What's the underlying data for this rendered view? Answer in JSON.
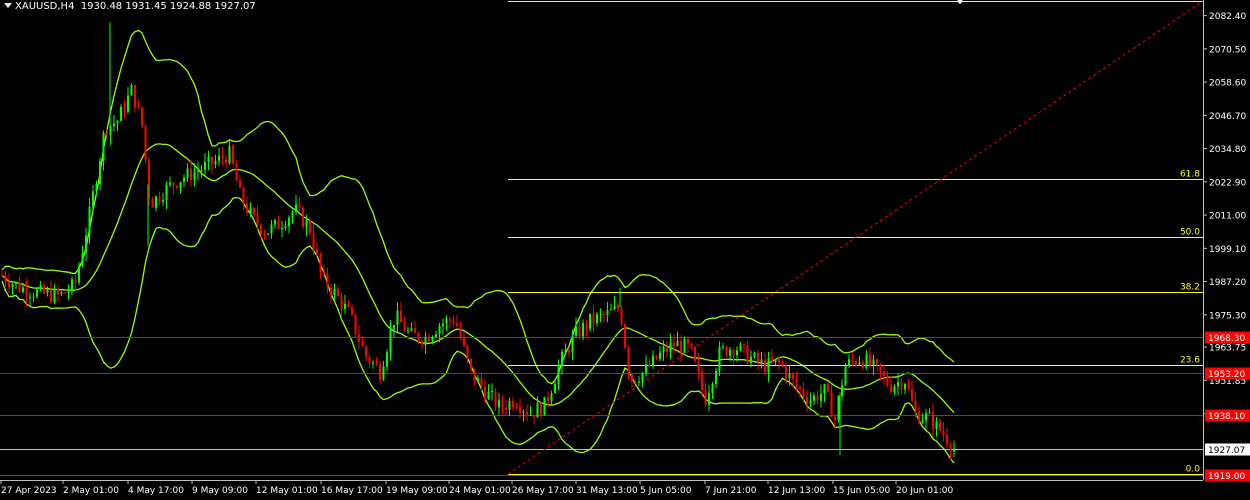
{
  "header": {
    "symbol": "XAUUSD,H4",
    "ohlc": "1930.48 1931.45 1924.88 1927.07"
  },
  "colors": {
    "background": "#000000",
    "bull": "#00ff00",
    "bear": "#ff0000",
    "bands": "#99ff00",
    "fib": "#ffff00",
    "level": "#ff0000",
    "text": "#ffffff"
  },
  "chart_data": {
    "type": "candlestick",
    "title": "XAUUSD,H4",
    "ylim": [
      1916.15,
      2088.0
    ],
    "price_ticks": [
      2082.4,
      2070.5,
      2058.6,
      2046.7,
      2034.8,
      2022.9,
      2011.0,
      1999.1,
      1987.2,
      1975.3,
      1963.75,
      1951.85,
      1939.95,
      1927.07,
      1916.15
    ],
    "date_labels": [
      "27 Apr 2023",
      "2 May 01:00",
      "4 May 17:00",
      "9 May 09:00",
      "12 May 01:00",
      "16 May 17:00",
      "19 May 09:00",
      "24 May 01:00",
      "26 May 17:00",
      "31 May 13:00",
      "5 Jun 05:00",
      "7 Jun 21:00",
      "12 Jun 13:00",
      "15 Jun 05:00",
      "20 Jun 01:00"
    ],
    "current_price": "1927.07",
    "fibonacci": [
      {
        "label": "61.8",
        "price": 2023.9
      },
      {
        "label": "50.0",
        "price": 2003.3
      },
      {
        "label": "38.2",
        "price": 1983.4
      },
      {
        "label": "23.6",
        "price": 1957.5
      },
      {
        "label": "0.0",
        "price": 1918.2
      },
      {
        "label": "",
        "price": 2087.6
      }
    ],
    "levels": [
      {
        "label": "1968.30",
        "price": 1967.3
      },
      {
        "label": "1953.20",
        "price": 1954.5
      },
      {
        "label": "1938.10",
        "price": 1939.3
      },
      {
        "label": "1919.00",
        "price": 1917.8
      }
    ],
    "close_path": [
      [
        0,
        1990
      ],
      [
        20,
        1985
      ],
      [
        40,
        1983
      ],
      [
        60,
        1982
      ],
      [
        75,
        1986
      ],
      [
        90,
        2012
      ],
      [
        105,
        2042
      ],
      [
        118,
        2045
      ],
      [
        132,
        2056
      ],
      [
        142,
        2043
      ],
      [
        150,
        2015
      ],
      [
        165,
        2020
      ],
      [
        180,
        2024
      ],
      [
        198,
        2027
      ],
      [
        215,
        2030
      ],
      [
        230,
        2033
      ],
      [
        240,
        2018
      ],
      [
        252,
        2010
      ],
      [
        266,
        2005
      ],
      [
        280,
        2008
      ],
      [
        295,
        2013
      ],
      [
        310,
        2006
      ],
      [
        322,
        1988
      ],
      [
        335,
        1983
      ],
      [
        350,
        1975
      ],
      [
        365,
        1961
      ],
      [
        380,
        1955
      ],
      [
        395,
        1975
      ],
      [
        410,
        1968
      ],
      [
        425,
        1967
      ],
      [
        440,
        1972
      ],
      [
        455,
        1974
      ],
      [
        470,
        1955
      ],
      [
        485,
        1948
      ],
      [
        500,
        1942
      ],
      [
        515,
        1945
      ],
      [
        530,
        1940
      ],
      [
        545,
        1943
      ],
      [
        560,
        1958
      ],
      [
        575,
        1968
      ],
      [
        590,
        1973
      ],
      [
        605,
        1975
      ],
      [
        620,
        1978
      ],
      [
        630,
        1952
      ],
      [
        645,
        1955
      ],
      [
        660,
        1961
      ],
      [
        675,
        1965
      ],
      [
        690,
        1963
      ],
      [
        705,
        1945
      ],
      [
        720,
        1962
      ],
      [
        735,
        1964
      ],
      [
        750,
        1960
      ],
      [
        765,
        1957
      ],
      [
        780,
        1958
      ],
      [
        795,
        1950
      ],
      [
        810,
        1945
      ],
      [
        825,
        1948
      ],
      [
        835,
        1938
      ],
      [
        845,
        1957
      ],
      [
        860,
        1960
      ],
      [
        875,
        1956
      ],
      [
        890,
        1950
      ],
      [
        905,
        1952
      ],
      [
        915,
        1940
      ],
      [
        930,
        1938
      ],
      [
        945,
        1932
      ],
      [
        955,
        1927
      ]
    ]
  }
}
